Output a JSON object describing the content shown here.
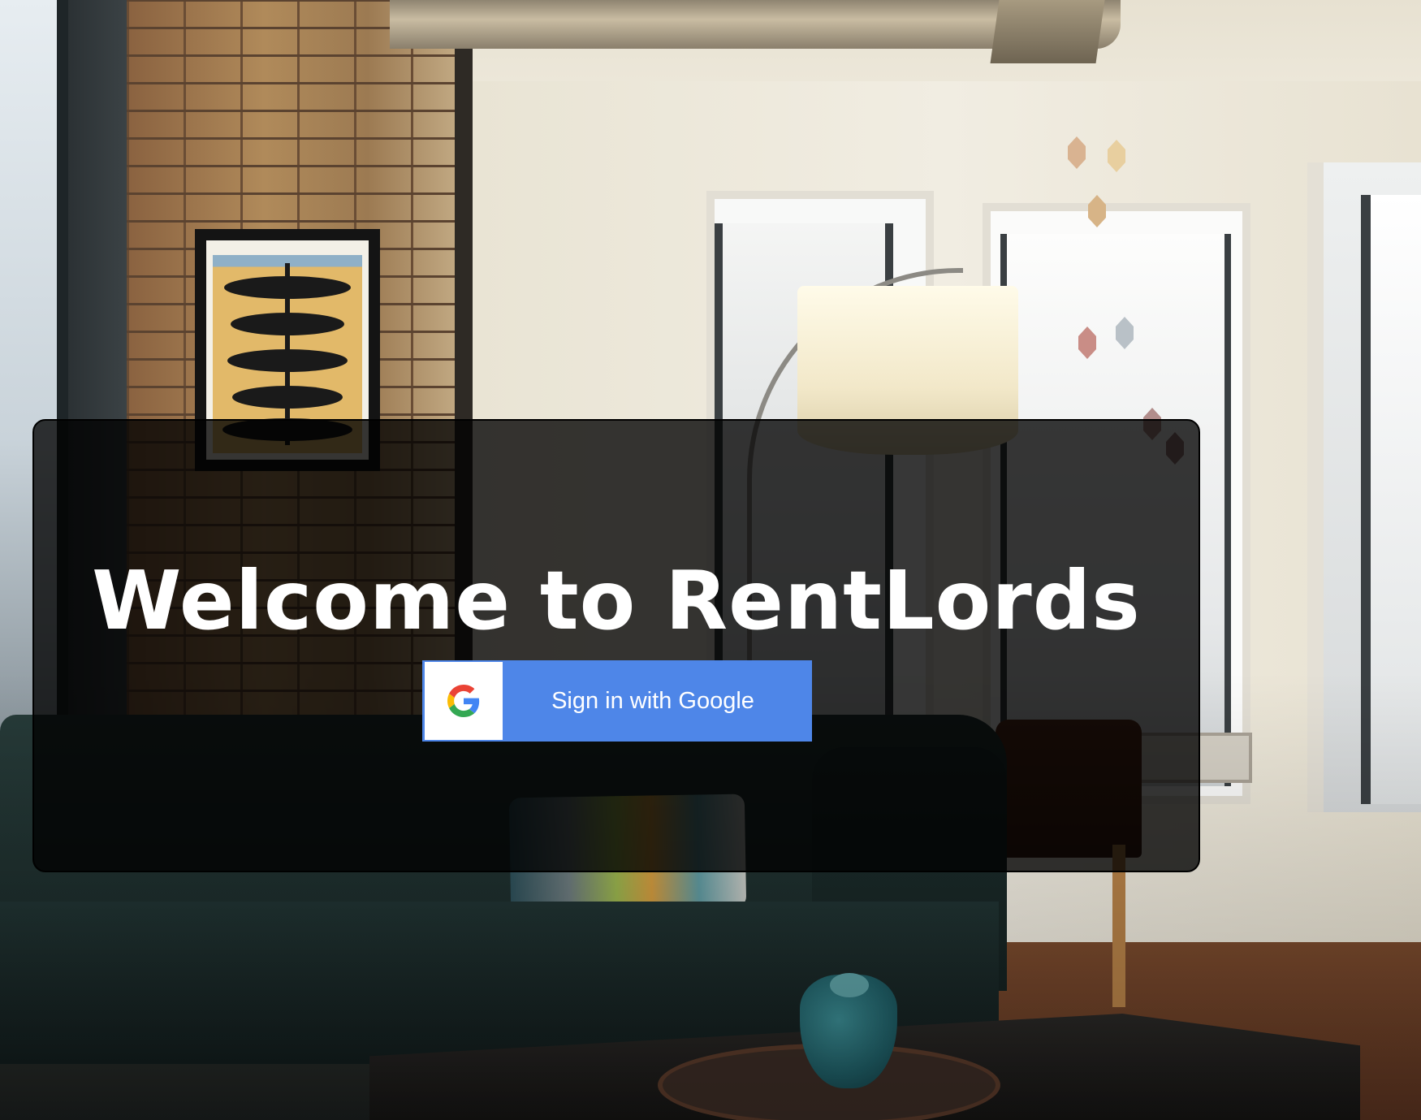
{
  "page": {
    "title": "Welcome to RentLords"
  },
  "login": {
    "google_button_label": "Sign in with Google",
    "google_icon": "google-g-icon"
  },
  "colors": {
    "button_blue": "#4e86e8",
    "overlay": "rgba(0,0,0,0.78)",
    "title_text": "#ffffff"
  }
}
